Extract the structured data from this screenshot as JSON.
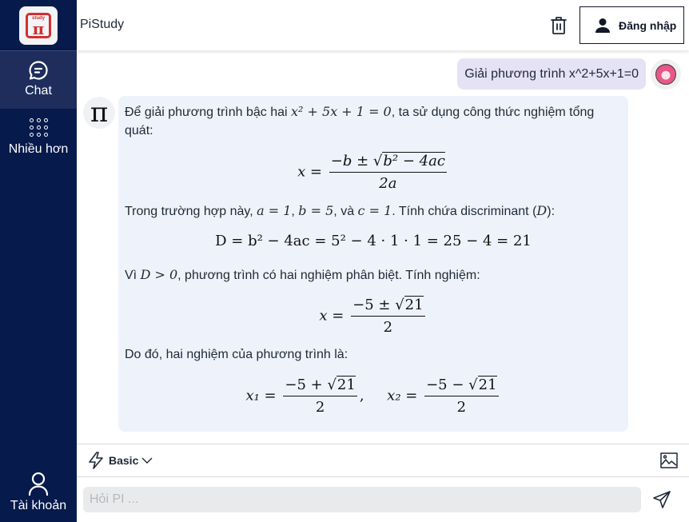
{
  "app": {
    "title": "PiStudy",
    "logo_text": "study",
    "logo_symbol": "π"
  },
  "sidebar": {
    "items": [
      {
        "label": "Chat",
        "icon": "chat-bubble-icon",
        "active": true
      },
      {
        "label": "Nhiều hơn",
        "icon": "grid-dots-icon",
        "active": false
      }
    ],
    "account": {
      "label": "Tài khoản",
      "icon": "user-outline-icon"
    }
  },
  "header": {
    "trash_icon": "trash-icon",
    "login_label": "Đăng nhập",
    "login_icon": "user-filled-icon"
  },
  "conversation": {
    "user_message": "Giải phương trình x^2+5x+1=0",
    "bot_avatar_symbol": "π",
    "bot": {
      "p1_before": "Để giải phương trình bậc hai ",
      "p1_math": "x² + 5x + 1 = 0",
      "p1_after": ", ta sử dụng công thức nghiệm tổng",
      "p1_line2": "quát:",
      "f1_lhs": "x =",
      "f1_num": "−b ± ",
      "f1_sqrt": "b² − 4ac",
      "f1_den": "2a",
      "p2_before": "Trong trường hợp này, ",
      "p2_a": "a = 1",
      "p2_sep1": ", ",
      "p2_b": "b = 5",
      "p2_sep2": ", và ",
      "p2_c": "c = 1",
      "p2_after": ". Tính chứa discriminant (",
      "p2_D": "D",
      "p2_end": "):",
      "f2": "D = b² − 4ac = 5² − 4 · 1 · 1 = 25 − 4 = 21",
      "p3_before": "Vì ",
      "p3_math": "D > 0",
      "p3_after": ", phương trình có hai nghiệm phân biệt. Tính nghiệm:",
      "f3_lhs": "x =",
      "f3_num": "−5 ± ",
      "f3_sqrt": "21",
      "f3_den": "2",
      "p4": "Do đó, hai nghiệm của phương trình là:",
      "f4_x1": "x₁ =",
      "f4_x1_num": "−5 + ",
      "f4_x1_sqrt": "21",
      "f4_x1_den": "2",
      "f4_sep": ",",
      "f4_x2": "x₂ =",
      "f4_x2_num": "−5 − ",
      "f4_x2_sqrt": "21",
      "f4_x2_den": "2"
    }
  },
  "mode_bar": {
    "mode_label": "Basic",
    "mode_icon": "lightning-icon",
    "image_icon": "image-icon"
  },
  "input": {
    "placeholder": "Hỏi PI ...",
    "value": "",
    "send_icon": "send-icon"
  }
}
